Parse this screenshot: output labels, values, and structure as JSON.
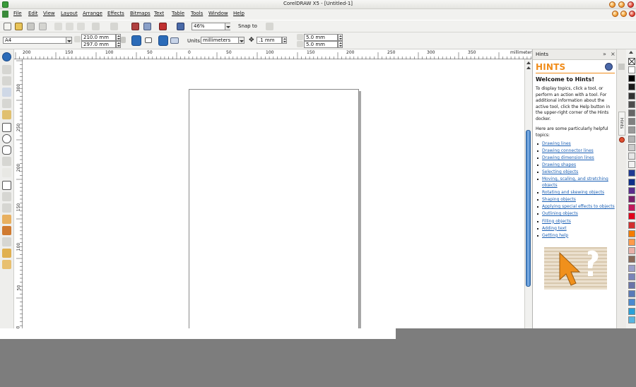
{
  "window": {
    "title": "CorelDRAW X5 - [Untitled-1]"
  },
  "menu": [
    "File",
    "Edit",
    "View",
    "Layout",
    "Arrange",
    "Effects",
    "Bitmaps",
    "Text",
    "Table",
    "Tools",
    "Window",
    "Help"
  ],
  "toolbar": {
    "zoom": "46%",
    "snap_to": "Snap to",
    "icons": [
      "new-icon",
      "open-icon",
      "save-icon",
      "print-icon",
      "cut-icon",
      "copy-icon",
      "paste-icon",
      "undo-icon",
      "redo-icon",
      "import-icon",
      "export-icon",
      "app-launcher-icon",
      "welcome-screen-icon",
      "zoom-levels-icon",
      "options-icon"
    ]
  },
  "propertybar": {
    "page_size": "A4",
    "width": "210.0 mm",
    "height": "297.0 mm",
    "units_label": "Units:",
    "units": "millimeters",
    "nudge": ".1 mm",
    "dup_x": "5.0 mm",
    "dup_y": "5.0 mm"
  },
  "ruler": {
    "unit": "millimeters",
    "h_labels": [
      "200",
      "150",
      "100",
      "50",
      "0",
      "50",
      "100",
      "150",
      "200",
      "250",
      "300",
      "350"
    ],
    "v_labels": [
      "300",
      "250",
      "200",
      "150",
      "100",
      "50",
      "0"
    ]
  },
  "tools": [
    "pick-tool-icon",
    "shape-tool-icon",
    "crop-tool-icon",
    "zoom-tool-icon",
    "freehand-tool-icon",
    "smart-fill-tool-icon",
    "rectangle-tool-icon",
    "ellipse-tool-icon",
    "polygon-tool-icon",
    "basic-shapes-tool-icon",
    "text-tool-icon",
    "table-tool-icon",
    "dimension-tool-icon",
    "connector-tool-icon",
    "blend-tool-icon",
    "eyedropper-tool-icon",
    "outline-tool-icon",
    "fill-tool-icon",
    "interactive-fill-tool-icon"
  ],
  "hints": {
    "panel_title": "Hints",
    "banner": "HINTS",
    "welcome": "Welcome to Hints!",
    "para1": "To display topics, click a tool, or perform an action with a tool. For additional information about the active tool, click the Help button in the upper-right corner of the Hints docker.",
    "para2": "Here are some particularly helpful topics:",
    "links": [
      "Drawing lines",
      "Drawing connector lines",
      "Drawing dimension lines",
      "Drawing shapes",
      "Selecting objects",
      "Moving, scaling, and stretching objects",
      "Rotating and skewing objects",
      "Shaping objects",
      "Applying special effects to objects",
      "Outlining objects",
      "Filling objects",
      "Adding text",
      "Getting help"
    ],
    "side_tab": "Hints"
  },
  "palette": [
    "#ffffff",
    "#000000",
    "#1a1a1a",
    "#333333",
    "#4d4d4d",
    "#666666",
    "#808080",
    "#999999",
    "#b3b3b3",
    "#cccccc",
    "#e6e6e6",
    "#f2f2f2",
    "#1f3a93",
    "#0f2f8a",
    "#5b2d8e",
    "#7a1f6a",
    "#c2185b",
    "#e2001a",
    "#d32f2f",
    "#f57c00",
    "#ff9a4a",
    "#e8b0a8",
    "#8a6a5a",
    "#9a9ec8",
    "#7a84b8",
    "#6a74a8",
    "#5a7ab8",
    "#4a8ad0",
    "#2aa0d8",
    "#5ab4e0"
  ],
  "colors": {
    "accent": "#f08c1a",
    "link": "#1a5fb4",
    "scroll_thumb": "#3d7fc7"
  }
}
